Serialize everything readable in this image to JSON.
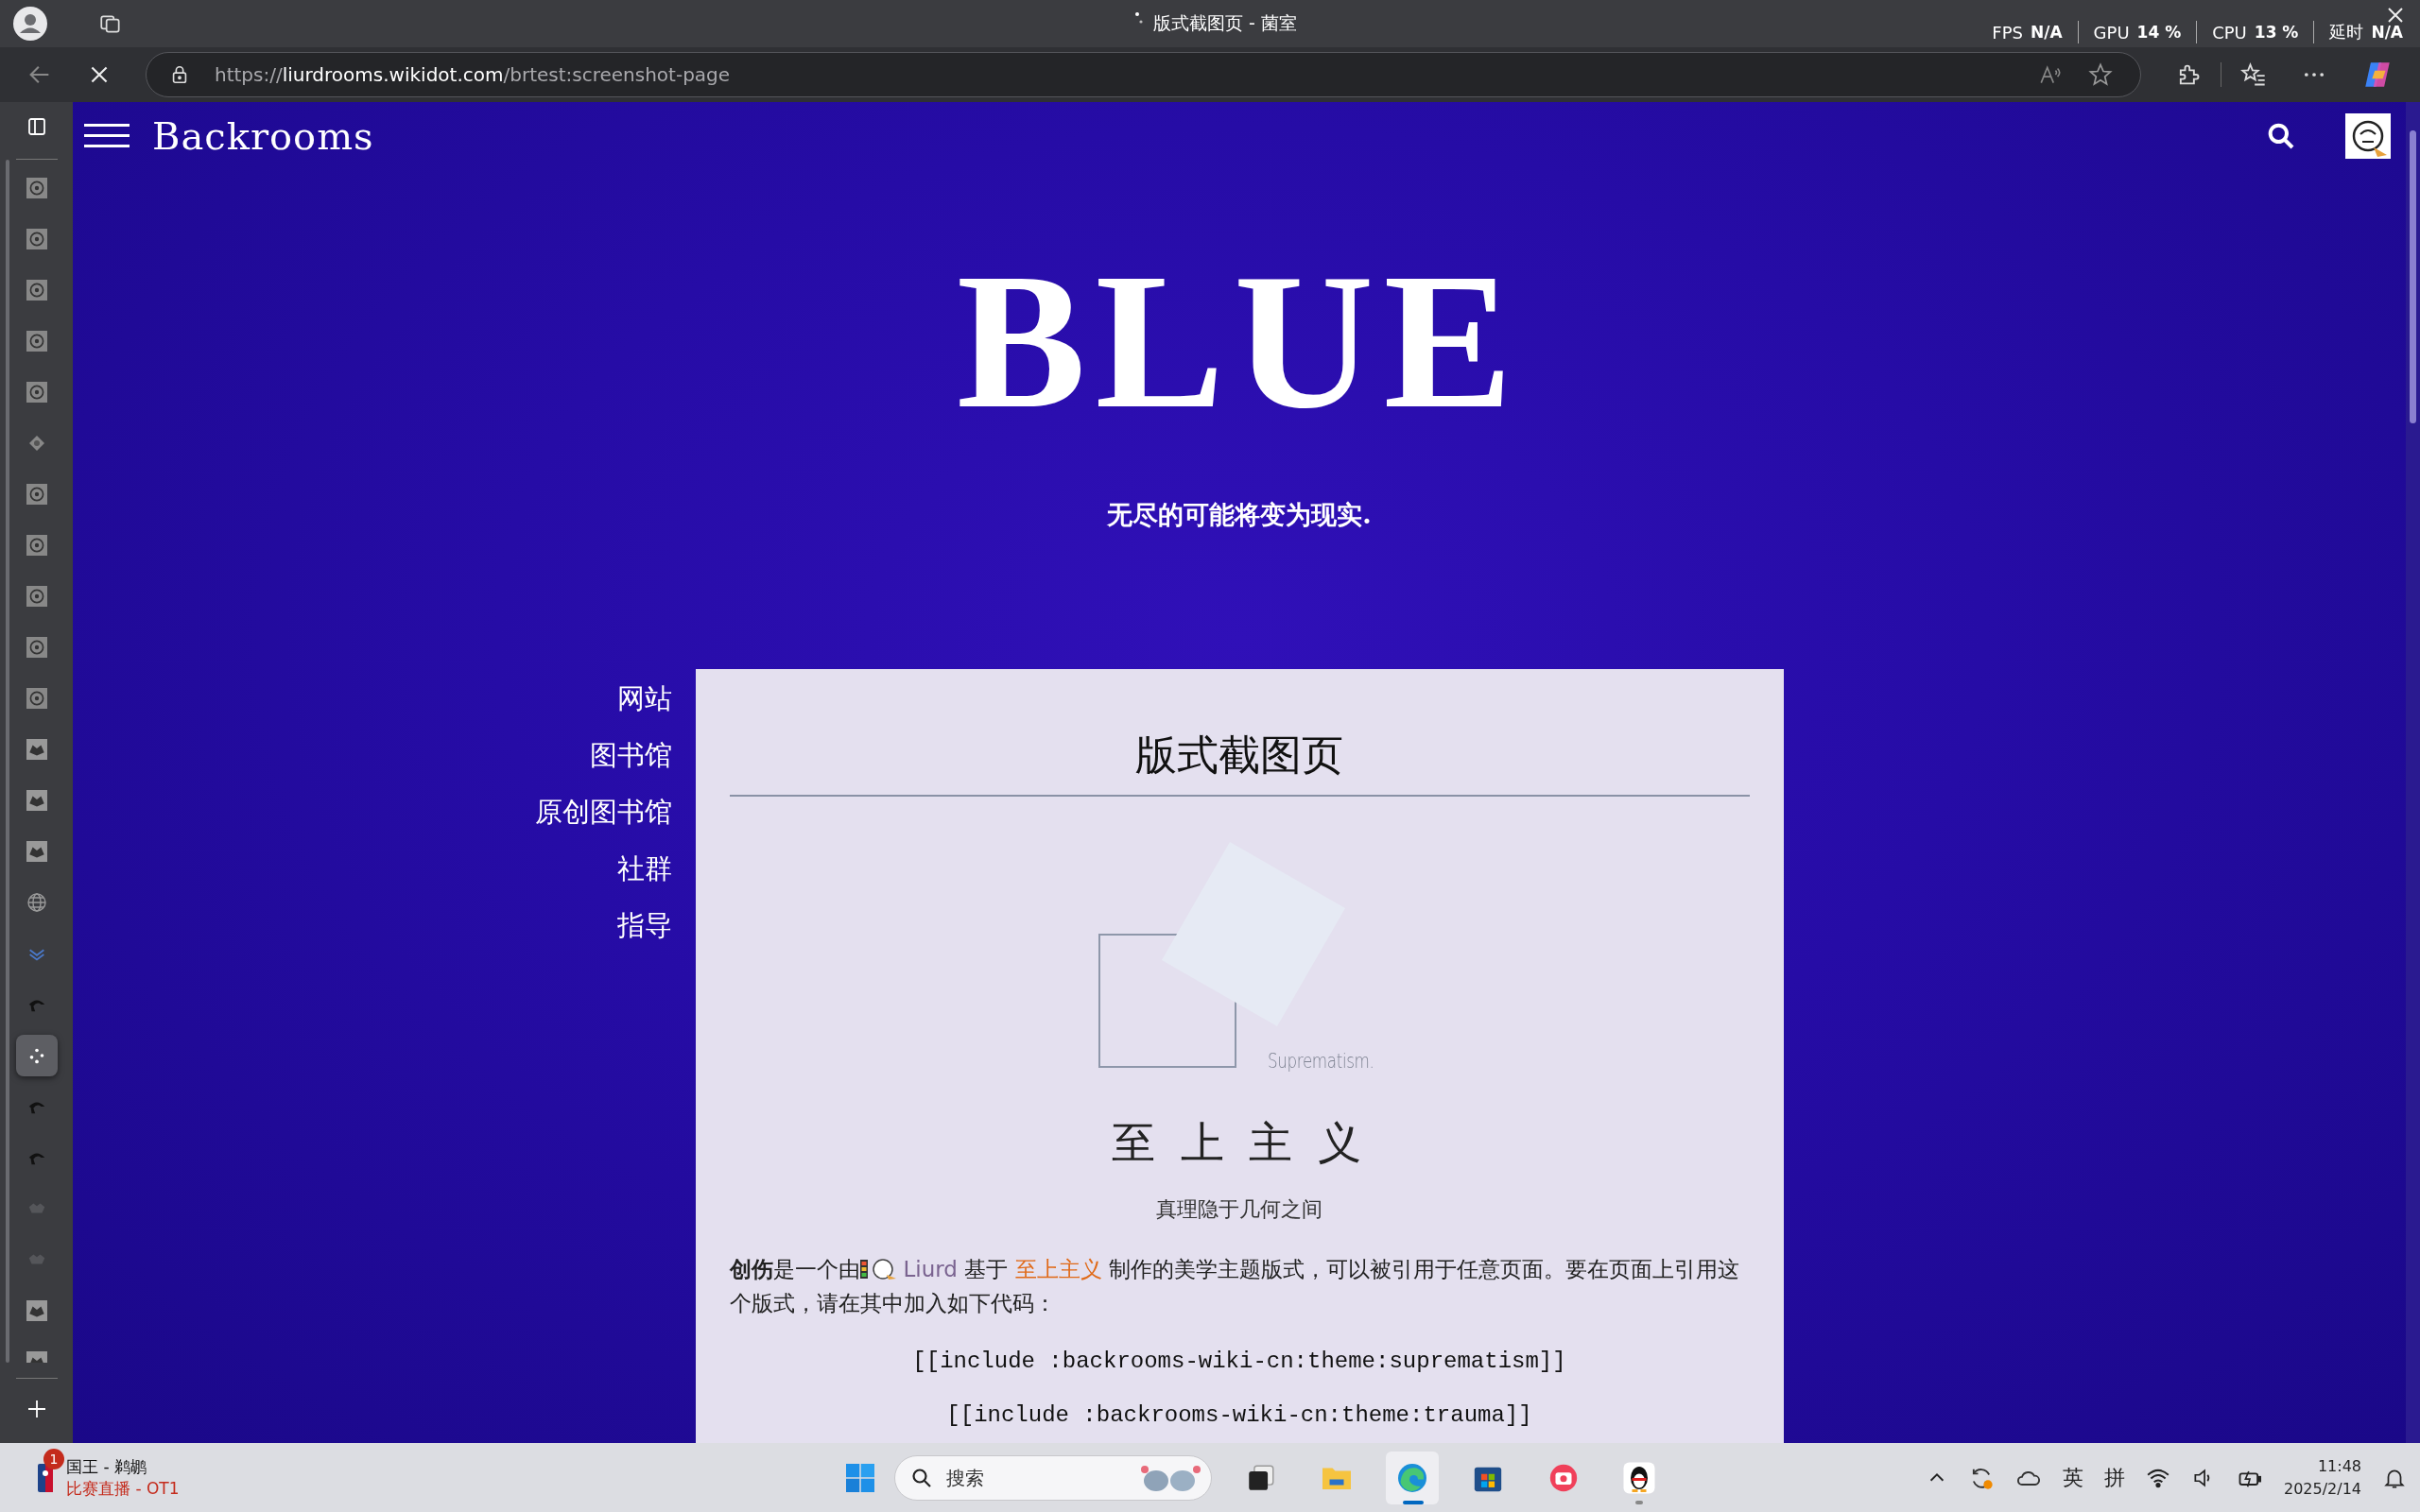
{
  "browser": {
    "tab_title": "版式截图页 - 菌室",
    "url": {
      "scheme": "https://",
      "domain": "liurdrooms.wikidot.com",
      "path": "/brtest:screenshot-page"
    },
    "metrics": [
      {
        "label": "FPS",
        "value": "N/A"
      },
      {
        "label": "GPU",
        "value": "14 %"
      },
      {
        "label": "CPU",
        "value": "13 %"
      },
      {
        "label": "延时",
        "value": "N/A"
      }
    ]
  },
  "vertical_tabs": [
    {
      "kind": "seal",
      "selected": false
    },
    {
      "kind": "seal",
      "selected": false
    },
    {
      "kind": "seal",
      "selected": false
    },
    {
      "kind": "seal",
      "selected": false
    },
    {
      "kind": "seal",
      "selected": false
    },
    {
      "kind": "diamond",
      "selected": false
    },
    {
      "kind": "seal",
      "selected": false
    },
    {
      "kind": "seal",
      "selected": false
    },
    {
      "kind": "seal",
      "selected": false
    },
    {
      "kind": "seal",
      "selected": false
    },
    {
      "kind": "seal",
      "selected": false
    },
    {
      "kind": "wolf",
      "selected": false
    },
    {
      "kind": "wolf",
      "selected": false
    },
    {
      "kind": "wolf",
      "selected": false
    },
    {
      "kind": "globe",
      "selected": false
    },
    {
      "kind": "layers",
      "selected": false
    },
    {
      "kind": "paw",
      "selected": false
    },
    {
      "kind": "dots",
      "selected": true
    },
    {
      "kind": "paw",
      "selected": false
    },
    {
      "kind": "paw",
      "selected": false
    },
    {
      "kind": "faded",
      "selected": false
    },
    {
      "kind": "faded",
      "selected": false
    },
    {
      "kind": "wolf",
      "selected": false
    },
    {
      "kind": "wolf",
      "selected": false
    }
  ],
  "site": {
    "name": "Backrooms",
    "hero_title": "BLUE",
    "tagline": "无尽的可能将变为现实.",
    "nav": [
      "网站",
      "图书馆",
      "原创图书馆",
      "社群",
      "指导"
    ]
  },
  "article": {
    "title": "版式截图页",
    "figure_caption": "Suprematism.",
    "heading": "至 上 主 义",
    "subheading": "真理隐于几何之间",
    "intro": "**创伤**是一个由",
    "author": "Liurd",
    "mid": " 基于 ",
    "theme_link": "至上主义",
    "rest": " 制作的美学主题版式，可以被引用于任意页面。要在页面上引用这个版式，请在其中加入如下代码：",
    "code": [
      "[[include :backrooms-wiki-cn:theme:suprematism]]",
      "[[include :backrooms-wiki-cn:theme:trauma]]"
    ]
  },
  "taskbar": {
    "widget": {
      "badge": "1",
      "title": "国王 - 鹈鹕",
      "subtitle": "比赛直播 - OT1"
    },
    "search_placeholder": "搜索",
    "apps": [
      {
        "kind": "taskview",
        "active": false,
        "running": false
      },
      {
        "kind": "folder",
        "active": false,
        "running": false
      },
      {
        "kind": "edge",
        "active": true,
        "running": true
      },
      {
        "kind": "store",
        "active": false,
        "running": false
      },
      {
        "kind": "camera",
        "active": false,
        "running": false
      },
      {
        "kind": "penguin",
        "active": false,
        "running": true
      }
    ],
    "input_modes": [
      "英",
      "拼"
    ],
    "time": "11:48",
    "date": "2025/2/14"
  }
}
